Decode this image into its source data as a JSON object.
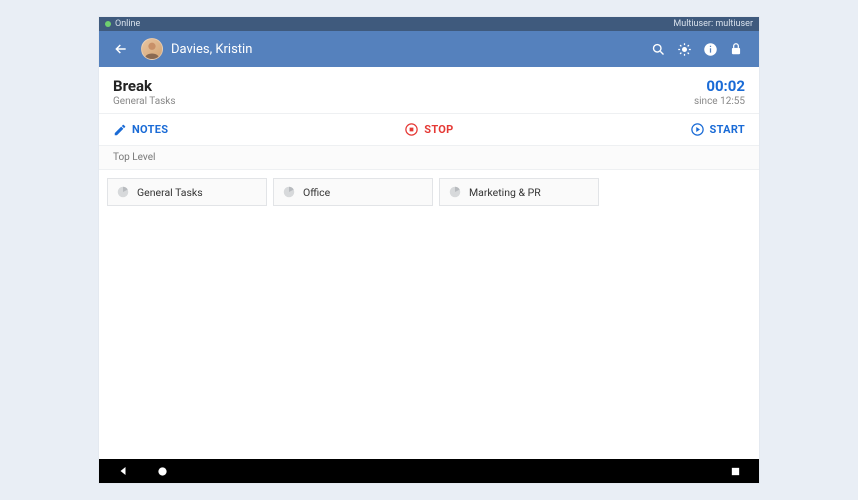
{
  "statusbar": {
    "online_label": "Online",
    "multiuser_label": "Multiuser: multiuser"
  },
  "header": {
    "username": "Davies, Kristin"
  },
  "task": {
    "title": "Break",
    "subtitle": "General Tasks",
    "timer": "00:02",
    "since": "since 12:55"
  },
  "actions": {
    "notes_label": "NOTES",
    "stop_label": "STOP",
    "start_label": "START"
  },
  "breadcrumb": "Top Level",
  "cards": [
    {
      "label": "General Tasks"
    },
    {
      "label": "Office"
    },
    {
      "label": "Marketing & PR"
    }
  ]
}
